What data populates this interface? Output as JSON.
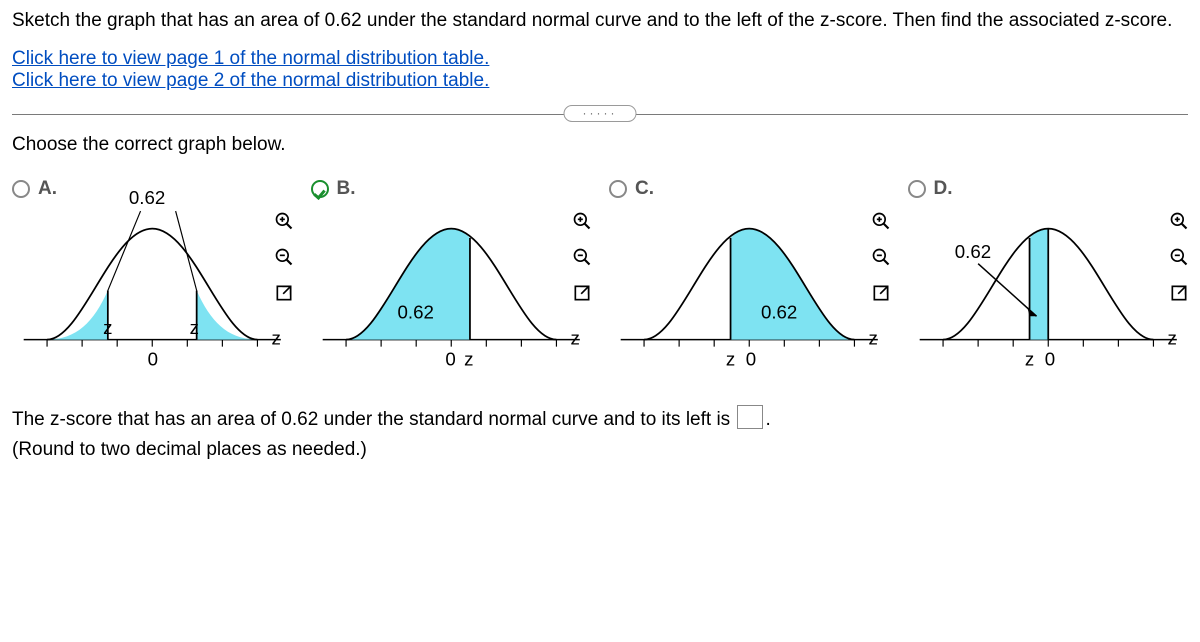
{
  "question": "Sketch the graph that has an area of 0.62 under the standard normal curve and to the left of the z-score. Then find the associated z-score.",
  "links": {
    "page1": "Click here to view page 1 of the normal distribution table.",
    "page2": "Click here to view page 2 of the normal distribution table."
  },
  "choose_prompt": "Choose the correct graph below.",
  "options": {
    "A": {
      "label": "A.",
      "shade_label": "0.62"
    },
    "B": {
      "label": "B.",
      "shade_label": "0.62"
    },
    "C": {
      "label": "C.",
      "shade_label": "0.62"
    },
    "D": {
      "label": "D.",
      "shade_label": "0.62"
    }
  },
  "selected": "B",
  "answer_sentence_pre": "The z-score that has an area of 0.62 under the standard normal curve and to its left is ",
  "answer_sentence_post": ".",
  "round_hint": "(Round to two decimal places as needed.)",
  "axis": {
    "z": "z",
    "zero": "0",
    "z0": "z0"
  }
}
